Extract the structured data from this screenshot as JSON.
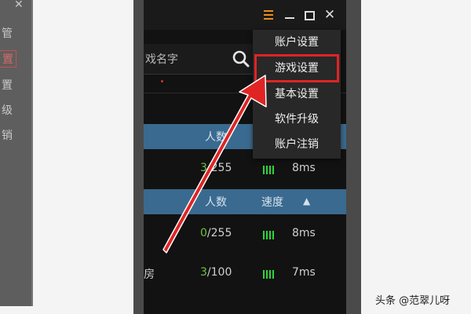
{
  "backdrop": {
    "ghost_items": [
      "管",
      "置",
      "置",
      "级",
      "销"
    ],
    "mini_close": "✕"
  },
  "titlebar": {
    "icons": [
      "menu-icon",
      "minimize-icon",
      "maximize-icon",
      "close-icon"
    ],
    "close_glyph": "✕"
  },
  "search": {
    "value": "戏名字"
  },
  "table": {
    "header1": {
      "count_label": "人数"
    },
    "header2": {
      "count_label": "人数",
      "speed_label": "速度",
      "sort_glyph": "▲"
    },
    "rows": [
      {
        "name": "",
        "count_current": "3",
        "count_total": "/255",
        "speed": "8ms"
      },
      {
        "name": "",
        "count_current": "0",
        "count_total": "/255",
        "speed": "8ms"
      },
      {
        "name": "房",
        "count_current": "3",
        "count_total": "/100",
        "speed": "7ms"
      }
    ]
  },
  "menu": {
    "items": [
      "账户设置",
      "游戏设置",
      "基本设置",
      "软件升级",
      "账户注销"
    ],
    "highlighted": "游戏设置"
  },
  "watermark": "头条 @范翠儿呀",
  "colors": {
    "accent_orange": "#f08c1a",
    "header_blue": "#3a6a8f",
    "highlight_red": "#e02424",
    "signal_green": "#2fd43a",
    "count_green": "#6cc43a"
  }
}
